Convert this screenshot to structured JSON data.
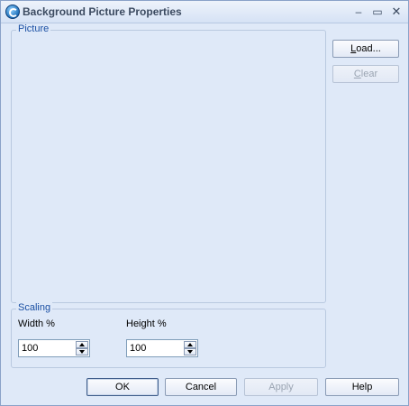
{
  "window": {
    "title": "Background Picture Properties",
    "min_glyph": "‒",
    "max_glyph": "▭",
    "close_glyph": "✕"
  },
  "picture": {
    "group_label": "Picture"
  },
  "side": {
    "load_pre": "",
    "load_u": "L",
    "load_post": "oad...",
    "clear_pre": "",
    "clear_u": "C",
    "clear_post": "lear"
  },
  "scaling": {
    "group_label": "Scaling",
    "width_label": "Width %",
    "width_value": "100",
    "height_label": "Height %",
    "height_value": "100"
  },
  "footer": {
    "ok": "OK",
    "cancel": "Cancel",
    "apply": "Apply",
    "help": "Help"
  },
  "colors": {
    "window_bg": "#dfe9f8",
    "group_title": "#1a4fa3",
    "disabled_text": "#9aa4b2"
  }
}
